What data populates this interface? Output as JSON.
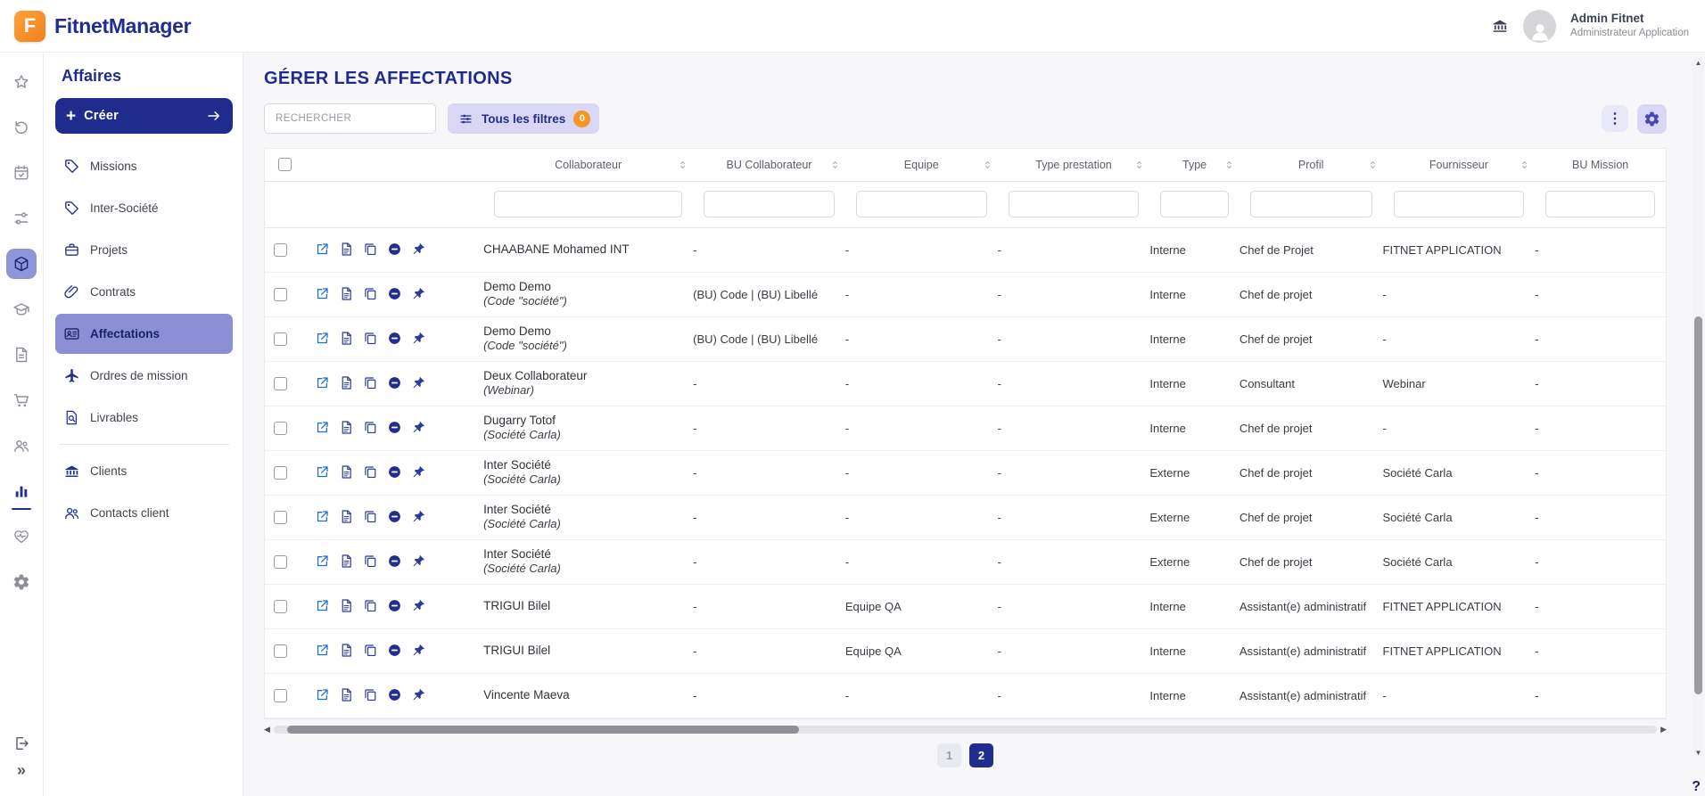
{
  "topbar": {
    "brand_fitnet": "Fitnet",
    "brand_manager": "Manager",
    "logo_letter": "F",
    "user_name": "Admin Fitnet",
    "user_role": "Administrateur Application"
  },
  "rail": {
    "icons": [
      "favorites-star",
      "history",
      "planning-calendar",
      "tune-sliders",
      "affaires-cube",
      "formation-cap",
      "documents",
      "purchases-cart",
      "people",
      "reports-chart",
      "health-heart",
      "settings-gear",
      "logout",
      "expand-chevrons"
    ]
  },
  "sidebar": {
    "section_title": "Affaires",
    "create_label": "Créer",
    "items": [
      {
        "label": "Missions"
      },
      {
        "label": "Inter-Société"
      },
      {
        "label": "Projets"
      },
      {
        "label": "Contrats"
      },
      {
        "label": "Affectations"
      },
      {
        "label": "Ordres de mission"
      },
      {
        "label": "Livrables"
      },
      {
        "label": "Clients"
      },
      {
        "label": "Contacts client"
      }
    ],
    "active_item": "Affectations"
  },
  "main": {
    "page_title": "GÉRER LES AFFECTATIONS",
    "search_placeholder": "RECHERCHER",
    "filters_label": "Tous les filtres",
    "filters_badge": "0",
    "dots_label": "⋮",
    "columns": [
      "Collaborateur",
      "BU Collaborateur",
      "Equipe",
      "Type prestation",
      "Type",
      "Profil",
      "Fournisseur",
      "BU Mission"
    ],
    "rows": [
      {
        "name": "CHAABANE Mohamed INT",
        "sub": "",
        "bu": "-",
        "equipe": "-",
        "prest": "-",
        "type": "Interne",
        "profil": "Chef de Projet",
        "fournisseur": "FITNET APPLICATION",
        "bu_mission": "-"
      },
      {
        "name": "Demo Demo",
        "sub": "(Code \"société\")",
        "bu": "(BU) Code | (BU) Libellé",
        "equipe": "-",
        "prest": "-",
        "type": "Interne",
        "profil": "Chef de projet",
        "fournisseur": "-",
        "bu_mission": "-"
      },
      {
        "name": "Demo Demo",
        "sub": "(Code \"société\")",
        "bu": "(BU) Code | (BU) Libellé",
        "equipe": "-",
        "prest": "-",
        "type": "Interne",
        "profil": "Chef de projet",
        "fournisseur": "-",
        "bu_mission": "-"
      },
      {
        "name": "Deux Collaborateur",
        "sub": "(Webinar)",
        "bu": "-",
        "equipe": "-",
        "prest": "-",
        "type": "Interne",
        "profil": "Consultant",
        "fournisseur": "Webinar",
        "bu_mission": "-"
      },
      {
        "name": "Dugarry Totof",
        "sub": "(Société Carla)",
        "bu": "-",
        "equipe": "-",
        "prest": "-",
        "type": "Interne",
        "profil": "Chef de projet",
        "fournisseur": "-",
        "bu_mission": "-"
      },
      {
        "name": "Inter Société",
        "sub": "(Société Carla)",
        "bu": "-",
        "equipe": "-",
        "prest": "-",
        "type": "Externe",
        "profil": "Chef de projet",
        "fournisseur": "Société Carla",
        "bu_mission": "-"
      },
      {
        "name": "Inter Société",
        "sub": "(Société Carla)",
        "bu": "-",
        "equipe": "-",
        "prest": "-",
        "type": "Externe",
        "profil": "Chef de projet",
        "fournisseur": "Société Carla",
        "bu_mission": "-"
      },
      {
        "name": "Inter Société",
        "sub": "(Société Carla)",
        "bu": "-",
        "equipe": "-",
        "prest": "-",
        "type": "Externe",
        "profil": "Chef de projet",
        "fournisseur": "Société Carla",
        "bu_mission": "-"
      },
      {
        "name": "TRIGUI Bilel",
        "sub": "",
        "bu": "-",
        "equipe": "Equipe QA",
        "prest": "-",
        "type": "Interne",
        "profil": "Assistant(e) administratif",
        "fournisseur": "FITNET APPLICATION",
        "bu_mission": "-"
      },
      {
        "name": "TRIGUI Bilel",
        "sub": "",
        "bu": "-",
        "equipe": "Equipe QA",
        "prest": "-",
        "type": "Interne",
        "profil": "Assistant(e) administratif",
        "fournisseur": "FITNET APPLICATION",
        "bu_mission": "-"
      },
      {
        "name": "Vincente Maeva",
        "sub": "",
        "bu": "-",
        "equipe": "-",
        "prest": "-",
        "type": "Interne",
        "profil": "Assistant(e) administratif",
        "fournisseur": "-",
        "bu_mission": "-"
      }
    ],
    "pagination": {
      "page1": "1",
      "page2": "2",
      "active": "2"
    },
    "help_label": "?"
  },
  "colors": {
    "navy": "#202d8c",
    "orange": "#f4801c",
    "badge_orange": "#f89422",
    "active_sidebar_bg": "#8b90d6",
    "filters_bg": "#d9d7f3",
    "main_bg": "#f7f7f9"
  }
}
